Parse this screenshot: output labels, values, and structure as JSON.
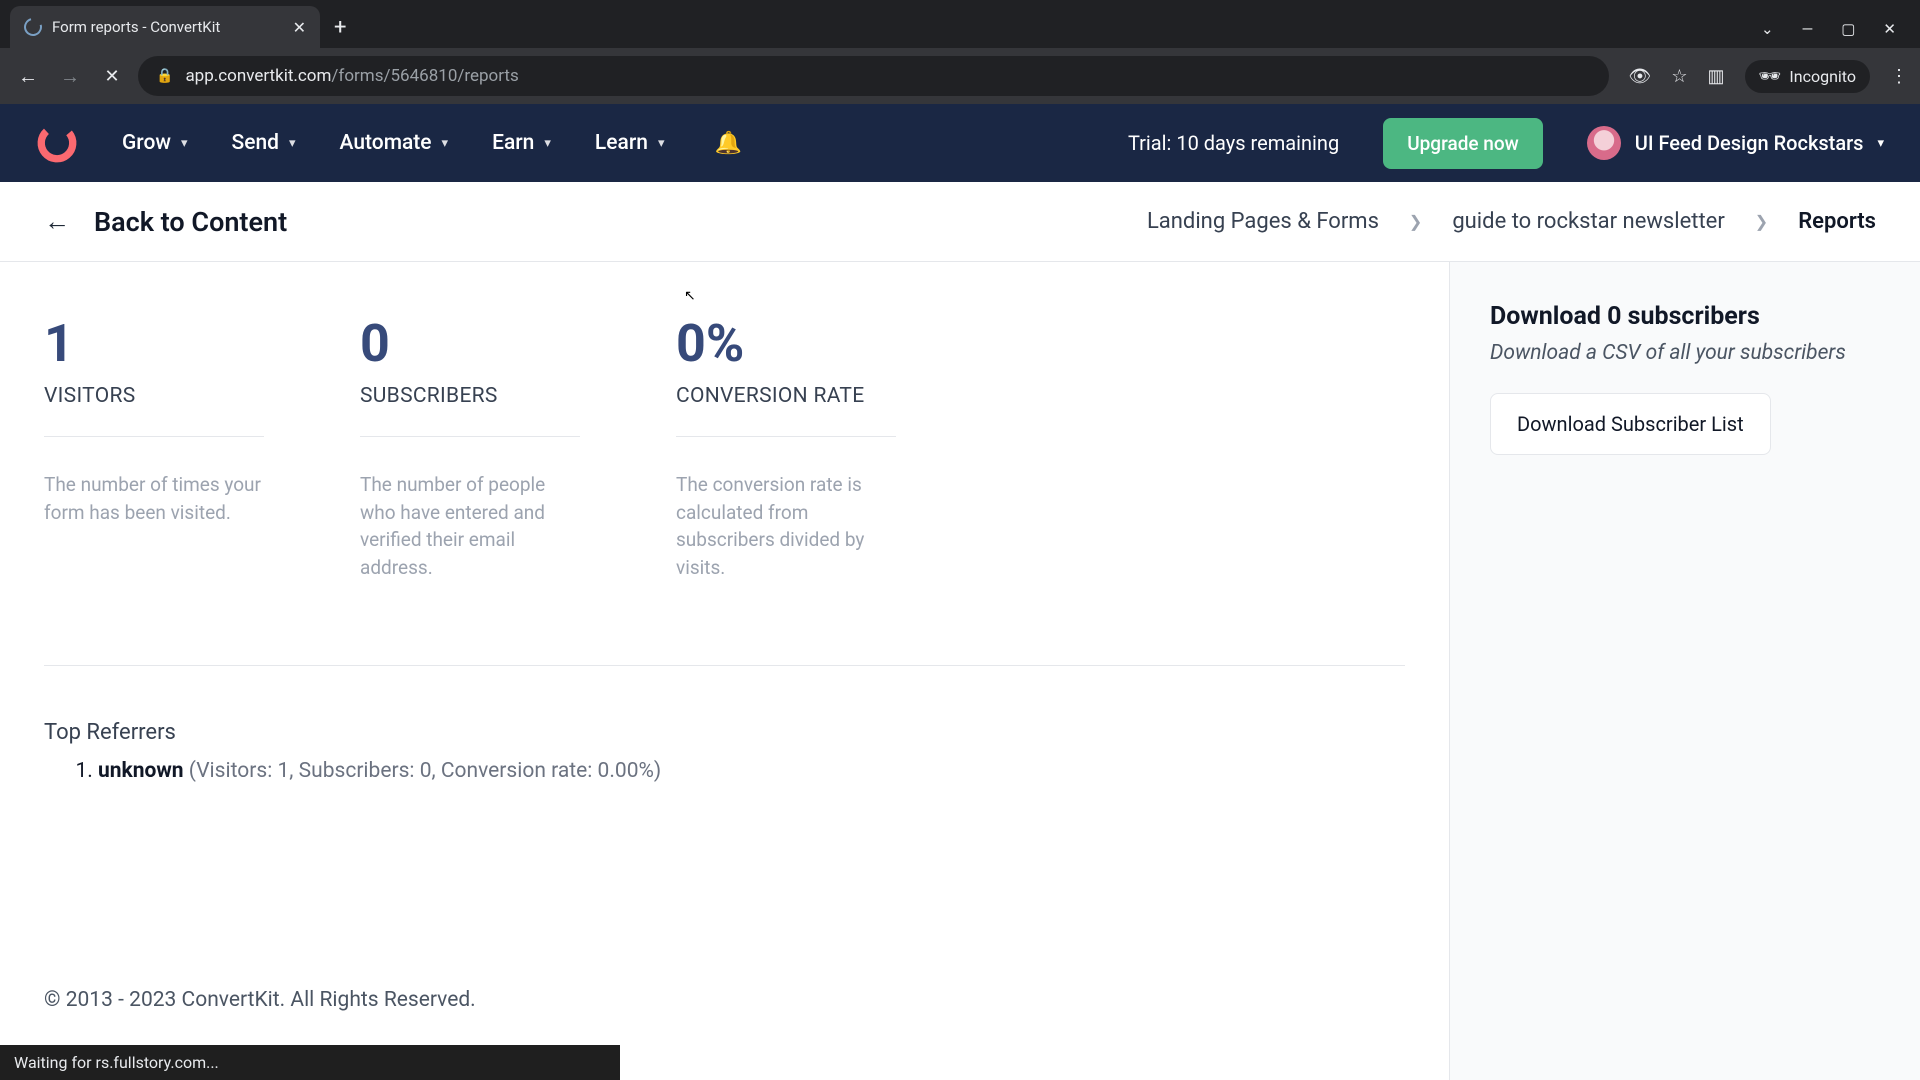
{
  "browser": {
    "tab_title": "Form reports - ConvertKit",
    "url_host": "app.convertkit.com",
    "url_path": "/forms/5646810/reports",
    "incognito": "Incognito"
  },
  "nav": {
    "items": [
      "Grow",
      "Send",
      "Automate",
      "Earn",
      "Learn"
    ],
    "trial": "Trial: 10 days remaining",
    "upgrade": "Upgrade now",
    "user": "UI Feed Design Rockstars"
  },
  "subheader": {
    "back": "Back to Content",
    "crumbs": [
      "Landing Pages & Forms",
      "guide to rockstar newsletter",
      "Reports"
    ]
  },
  "stats": [
    {
      "value": "1",
      "label": "VISITORS",
      "desc": "The number of times your form has been visited."
    },
    {
      "value": "0",
      "label": "SUBSCRIBERS",
      "desc": "The number of people who have entered and verified their email address."
    },
    {
      "value": "0%",
      "label": "CONVERSION RATE",
      "desc": "The conversion rate is calculated from subscribers divided by visits."
    }
  ],
  "referrers": {
    "title": "Top Referrers",
    "items": [
      {
        "name": "unknown",
        "meta": "(Visitors: 1, Subscribers: 0, Conversion rate: 0.00%)"
      }
    ]
  },
  "sidebar": {
    "title": "Download 0 subscribers",
    "subtitle": "Download a CSV of all your subscribers",
    "button": "Download Subscriber List"
  },
  "footer": "© 2013 - 2023 ConvertKit. All Rights Reserved.",
  "status": "Waiting for rs.fullstory.com..."
}
